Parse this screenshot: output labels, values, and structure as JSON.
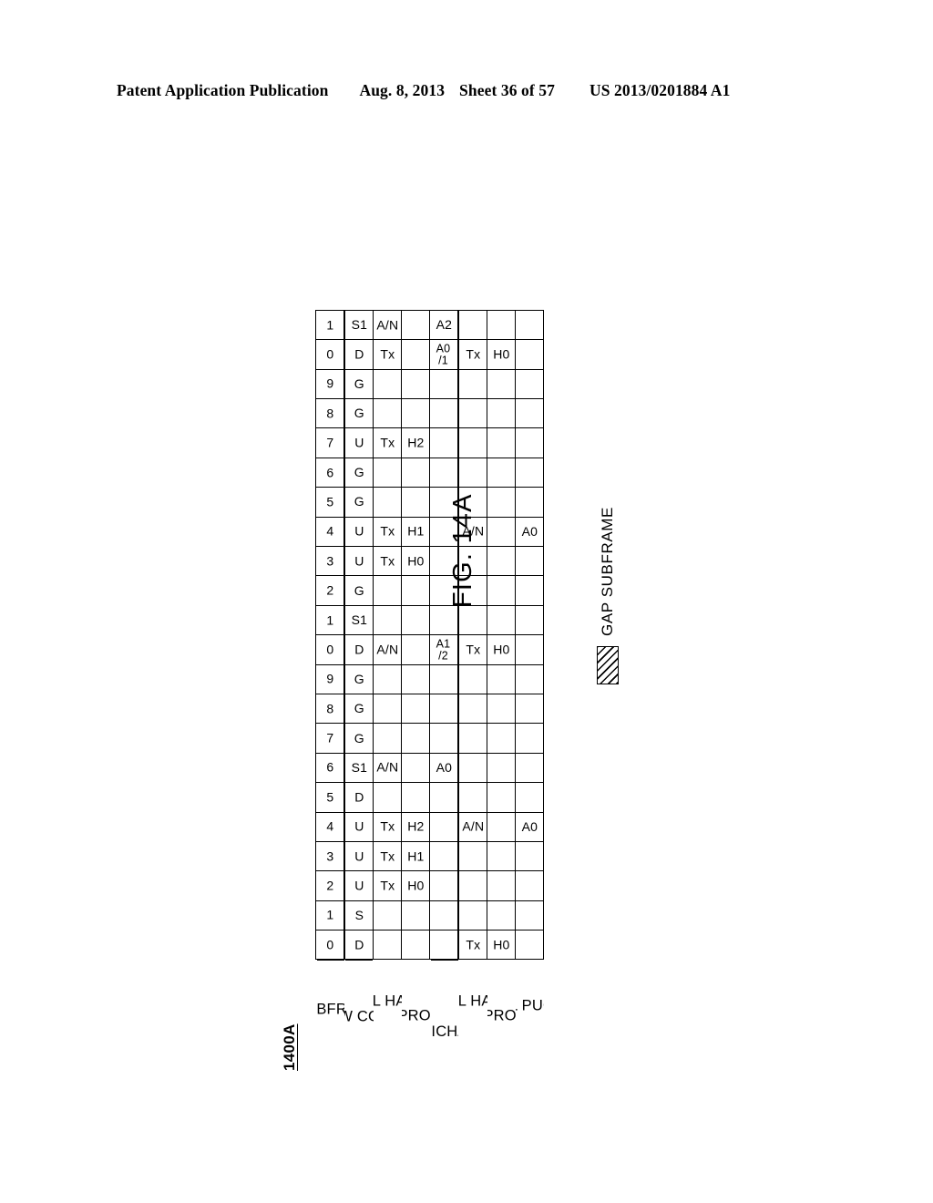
{
  "header": {
    "publication": "Patent Application Publication",
    "date": "Aug. 8, 2013",
    "sheet": "Sheet 36 of 57",
    "patent_number": "US 2013/0201884 A1"
  },
  "figure": {
    "reference_numeral": "1400A",
    "caption": "FIG. 14A",
    "legend": {
      "swatch": "hatched-box",
      "label": "GAP  SUBFRAME"
    }
  },
  "table": {
    "row_labels": [
      "SUBFRAME",
      "NEW CONFIG",
      "UL HARQ",
      "UL  PROCESS",
      "DL  PHICH/PDCCH",
      "DL HARQ",
      "DL  PROCESS",
      "UL  PUCCH"
    ],
    "subframes": [
      "0",
      "1",
      "2",
      "3",
      "4",
      "5",
      "6",
      "7",
      "8",
      "9",
      "0",
      "1",
      "2",
      "3",
      "4",
      "5",
      "6",
      "7",
      "8",
      "9",
      "0",
      "1"
    ],
    "rows": {
      "new_config": [
        {
          "t": "D"
        },
        {
          "t": "S"
        },
        {
          "t": "U"
        },
        {
          "t": "U"
        },
        {
          "t": "U"
        },
        {
          "t": "D"
        },
        {
          "t": "S1",
          "gap": true
        },
        {
          "t": "G",
          "gap": true
        },
        {
          "t": "G",
          "gap": true
        },
        {
          "t": "G",
          "gap": true
        },
        {
          "t": "D"
        },
        {
          "t": "S1",
          "gap": true
        },
        {
          "t": "G",
          "gap": true
        },
        {
          "t": "U"
        },
        {
          "t": "U"
        },
        {
          "t": "G",
          "gap": true
        },
        {
          "t": "G",
          "gap": true
        },
        {
          "t": "U"
        },
        {
          "t": "G",
          "gap": true
        },
        {
          "t": "G",
          "gap": true
        },
        {
          "t": "D"
        },
        {
          "t": "S1",
          "gap": true
        }
      ],
      "ul_harq": [
        {
          "t": ""
        },
        {
          "t": ""
        },
        {
          "t": "Tx"
        },
        {
          "t": "Tx"
        },
        {
          "t": "Tx"
        },
        {
          "t": ""
        },
        {
          "t": "A/N",
          "gap": true
        },
        {
          "t": "",
          "gap": true
        },
        {
          "t": "",
          "gap": true
        },
        {
          "t": "",
          "gap": true
        },
        {
          "t": "A/N"
        },
        {
          "t": "",
          "gap": true
        },
        {
          "t": "",
          "gap": true
        },
        {
          "t": "Tx"
        },
        {
          "t": "Tx"
        },
        {
          "t": "",
          "gap": true
        },
        {
          "t": "",
          "gap": true
        },
        {
          "t": "Tx"
        },
        {
          "t": "",
          "gap": true
        },
        {
          "t": "",
          "gap": true
        },
        {
          "t": "Tx"
        },
        {
          "t": "A/N",
          "gap": true
        }
      ],
      "ul_process": [
        {
          "t": ""
        },
        {
          "t": ""
        },
        {
          "t": "H0"
        },
        {
          "t": "H1"
        },
        {
          "t": "H2"
        },
        {
          "t": ""
        },
        {
          "t": "",
          "gap": true
        },
        {
          "t": "",
          "gap": true
        },
        {
          "t": "",
          "gap": true
        },
        {
          "t": "",
          "gap": true
        },
        {
          "t": ""
        },
        {
          "t": "",
          "gap": true
        },
        {
          "t": "",
          "gap": true
        },
        {
          "t": "H0"
        },
        {
          "t": "H1"
        },
        {
          "t": "",
          "gap": true
        },
        {
          "t": "",
          "gap": true
        },
        {
          "t": "H2"
        },
        {
          "t": "",
          "gap": true
        },
        {
          "t": "",
          "gap": true
        },
        {
          "t": ""
        },
        {
          "t": "",
          "gap": true
        }
      ],
      "dl_phich_pdcch": [
        {
          "t": ""
        },
        {
          "t": ""
        },
        {
          "t": ""
        },
        {
          "t": ""
        },
        {
          "t": ""
        },
        {
          "t": ""
        },
        {
          "t": "A0",
          "gap": true
        },
        {
          "t": "",
          "gap": true
        },
        {
          "t": "",
          "gap": true
        },
        {
          "t": "",
          "gap": true
        },
        {
          "t": "A1",
          "b": "/2"
        },
        {
          "t": "",
          "gap": true
        },
        {
          "t": "",
          "gap": true
        },
        {
          "t": ""
        },
        {
          "t": ""
        },
        {
          "t": "",
          "gap": true
        },
        {
          "t": "",
          "gap": true
        },
        {
          "t": ""
        },
        {
          "t": "",
          "gap": true
        },
        {
          "t": "",
          "gap": true
        },
        {
          "t": "A0",
          "b": "/1"
        },
        {
          "t": "A2",
          "gap": true
        }
      ],
      "dl_harq": [
        {
          "t": "Tx"
        },
        {
          "t": ""
        },
        {
          "t": ""
        },
        {
          "t": ""
        },
        {
          "t": "A/N"
        },
        {
          "t": ""
        },
        {
          "t": "",
          "gap": true
        },
        {
          "t": "",
          "gap": true
        },
        {
          "t": "",
          "gap": true
        },
        {
          "t": "",
          "gap": true
        },
        {
          "t": "Tx"
        },
        {
          "t": "",
          "gap": true
        },
        {
          "t": "",
          "gap": true
        },
        {
          "t": ""
        },
        {
          "t": "A/N"
        },
        {
          "t": "",
          "gap": true
        },
        {
          "t": "",
          "gap": true
        },
        {
          "t": ""
        },
        {
          "t": "",
          "gap": true
        },
        {
          "t": "",
          "gap": true
        },
        {
          "t": "Tx"
        },
        {
          "t": "",
          "gap": true
        }
      ],
      "dl_process": [
        {
          "t": "H0"
        },
        {
          "t": ""
        },
        {
          "t": ""
        },
        {
          "t": ""
        },
        {
          "t": ""
        },
        {
          "t": ""
        },
        {
          "t": "",
          "gap": true
        },
        {
          "t": "",
          "gap": true
        },
        {
          "t": "",
          "gap": true
        },
        {
          "t": "",
          "gap": true
        },
        {
          "t": "H0"
        },
        {
          "t": "",
          "gap": true
        },
        {
          "t": "",
          "gap": true
        },
        {
          "t": ""
        },
        {
          "t": ""
        },
        {
          "t": "",
          "gap": true
        },
        {
          "t": "",
          "gap": true
        },
        {
          "t": ""
        },
        {
          "t": "",
          "gap": true
        },
        {
          "t": "",
          "gap": true
        },
        {
          "t": "H0"
        },
        {
          "t": "",
          "gap": true
        }
      ],
      "ul_pucch": [
        {
          "t": ""
        },
        {
          "t": ""
        },
        {
          "t": ""
        },
        {
          "t": ""
        },
        {
          "t": "A0"
        },
        {
          "t": ""
        },
        {
          "t": "",
          "gap": true
        },
        {
          "t": "",
          "gap": true
        },
        {
          "t": "",
          "gap": true
        },
        {
          "t": "",
          "gap": true
        },
        {
          "t": ""
        },
        {
          "t": "",
          "gap": true
        },
        {
          "t": "",
          "gap": true
        },
        {
          "t": ""
        },
        {
          "t": "A0"
        },
        {
          "t": "",
          "gap": true
        },
        {
          "t": "",
          "gap": true
        },
        {
          "t": ""
        },
        {
          "t": "",
          "gap": true
        },
        {
          "t": "",
          "gap": true
        },
        {
          "t": ""
        },
        {
          "t": "",
          "gap": true
        }
      ]
    }
  }
}
